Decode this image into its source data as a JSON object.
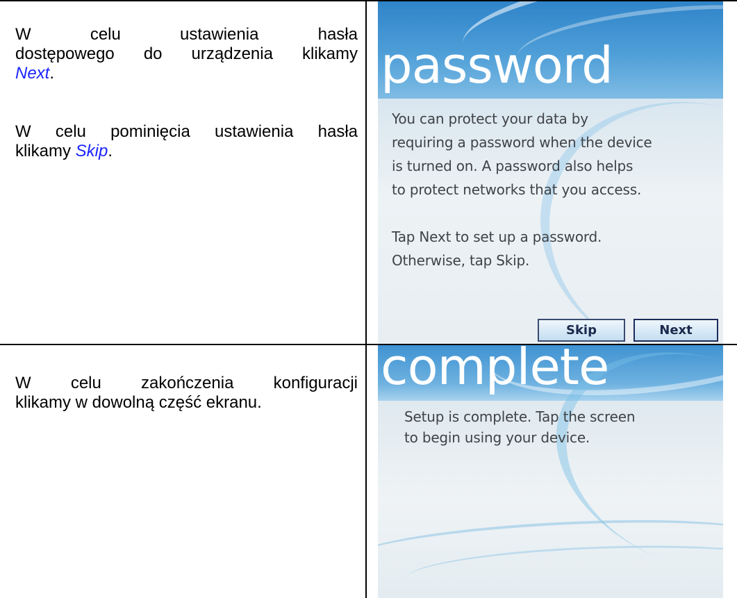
{
  "rows": [
    {
      "instruction": {
        "para1_lines": [
          "W celu ustawienia hasła",
          "dostępowego do urządzenia klikamy"
        ],
        "para1_link": "Next",
        "para1_end": ".",
        "para2_line1": "W celu pominięcia ustawienia hasła",
        "para2_prefix": "klikamy ",
        "para2_link": "Skip",
        "para2_end": "."
      },
      "screen": {
        "title": "password",
        "body_lines": [
          "You can protect your data by",
          "requiring a password when the device",
          "is turned on. A password also helps",
          "to protect networks that you access.",
          "",
          "Tap Next to set up a password.",
          "Otherwise, tap Skip."
        ],
        "buttons": {
          "skip": "Skip",
          "next": "Next"
        }
      }
    },
    {
      "instruction": {
        "lines": [
          "W celu zakończenia konfiguracji",
          "klikamy w dowolną część ekranu."
        ]
      },
      "screen": {
        "title": "complete",
        "body_lines": [
          "Setup is complete. Tap the screen",
          "to begin using your device."
        ]
      }
    }
  ],
  "colors": {
    "link": "#1a24ff",
    "screen_header": "#3b8fd0",
    "screen_text": "#3f4348"
  }
}
